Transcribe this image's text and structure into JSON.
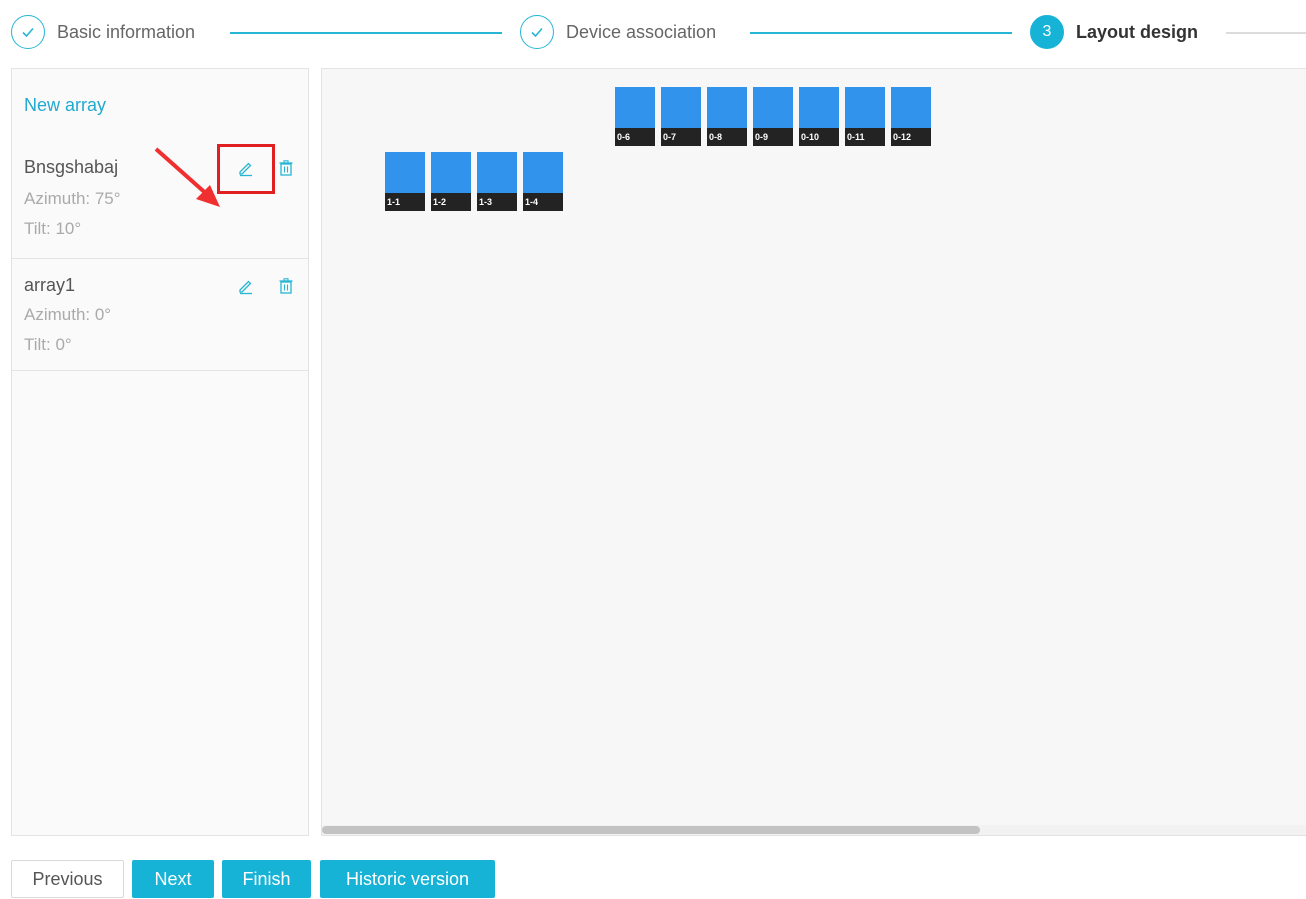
{
  "steps": [
    {
      "label": "Basic information",
      "status": "done",
      "icon": "check-icon"
    },
    {
      "label": "Device association",
      "status": "done",
      "icon": "check-icon"
    },
    {
      "number": "3",
      "label": "Layout design",
      "status": "active"
    }
  ],
  "sidebar": {
    "new_array_label": "New array",
    "arrays": [
      {
        "name": "Bnsgshabaj",
        "azimuth": "Azimuth: 75°",
        "tilt": "Tilt: 10°",
        "highlighted": true
      },
      {
        "name": "array1",
        "azimuth": "Azimuth: 0°",
        "tilt": "Tilt: 0°"
      }
    ]
  },
  "canvas": {
    "panel_rows": [
      {
        "labels": [
          "0-6",
          "0-7",
          "0-8",
          "0-9",
          "0-10",
          "0-11",
          "0-12"
        ]
      },
      {
        "labels": [
          "1-1",
          "1-2",
          "1-3",
          "1-4"
        ]
      }
    ]
  },
  "footer": {
    "previous_label": "Previous",
    "next_label": "Next",
    "finish_label": "Finish",
    "historic_label": "Historic version"
  },
  "colors": {
    "accent": "#17b3d6",
    "panel": "#3193ec",
    "panel_label_bg": "#232323",
    "highlight": "#e02020"
  }
}
